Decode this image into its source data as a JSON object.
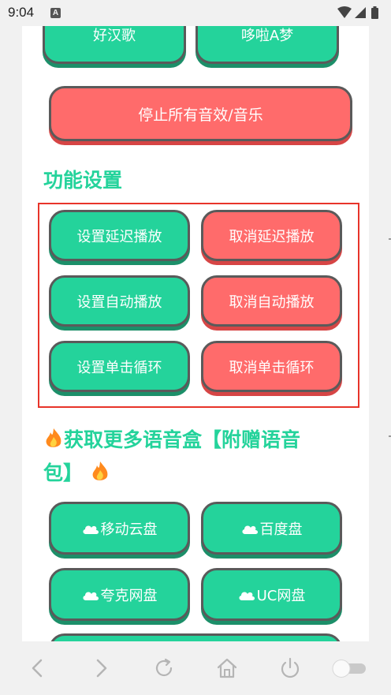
{
  "status_bar": {
    "time": "9:04",
    "notification_icon": "A"
  },
  "top_buttons": [
    {
      "label": "好汉歌",
      "color": "#24d39b"
    },
    {
      "label": "哆啦A梦",
      "color": "#24d39b"
    }
  ],
  "stop_all": {
    "label": "停止所有音效/音乐",
    "color": "#ff6b6b"
  },
  "settings": {
    "title": "功能设置",
    "buttons": [
      {
        "label": "设置延迟播放"
      },
      {
        "label": "取消延迟播放"
      },
      {
        "label": "设置自动播放"
      },
      {
        "label": "取消自动播放"
      },
      {
        "label": "设置单击循环"
      },
      {
        "label": "取消单击循环"
      }
    ]
  },
  "more": {
    "title_line1": "获取更多语音盒【附赠语音",
    "title_line2": "包】",
    "icon": "fire-icon",
    "links": [
      {
        "label": "移动云盘",
        "icon": "cloud-icon"
      },
      {
        "label": "百度盘",
        "icon": "cloud-icon"
      },
      {
        "label": "夸克网盘",
        "icon": "cloud-icon"
      },
      {
        "label": "UC网盘",
        "icon": "cloud-icon"
      }
    ]
  },
  "colors": {
    "accent_green": "#24d39b",
    "accent_red": "#ff6b6b",
    "frame_red": "#e8342a"
  }
}
